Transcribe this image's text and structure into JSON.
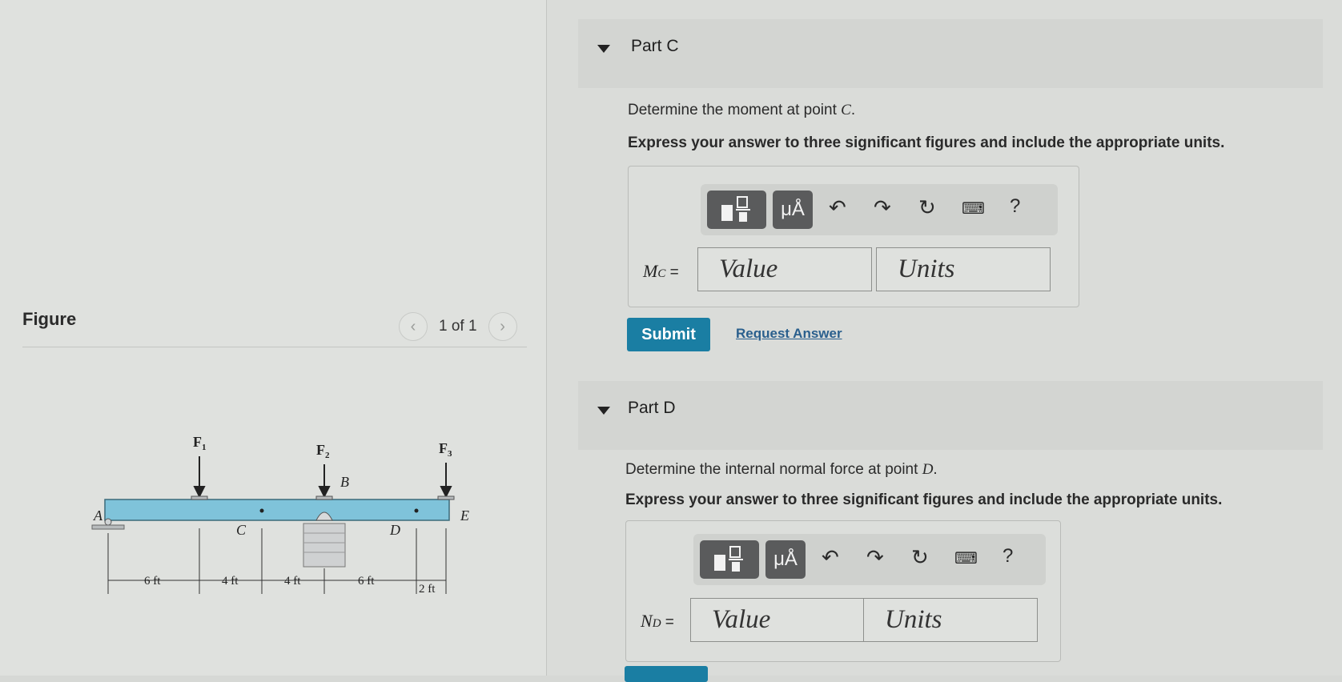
{
  "figure_panel": {
    "heading": "Figure",
    "pager_text": "1 of 1",
    "prev_icon": "chevron-left-icon",
    "next_icon": "chevron-right-icon",
    "diagram": {
      "forces": [
        "F1",
        "F2",
        "F3"
      ],
      "points": [
        "A",
        "B",
        "C",
        "D",
        "E"
      ],
      "dimensions": [
        "6 ft",
        "4 ft",
        "4 ft",
        "6 ft",
        "2 ft"
      ]
    }
  },
  "part_c": {
    "title": "Part C",
    "question_prefix": "Determine the moment at point ",
    "question_var": "C",
    "question_suffix": ".",
    "instruction": "Express your answer to three significant figures and include the appropriate units.",
    "label_main": "M",
    "label_sub": "C",
    "label_eq": " =",
    "value_placeholder": "Value",
    "units_placeholder": "Units",
    "submit_label": "Submit",
    "request_label": "Request Answer"
  },
  "part_d": {
    "title": "Part D",
    "question_prefix": "Determine the internal normal force at point ",
    "question_var": "D",
    "question_suffix": ".",
    "instruction": "Express your answer to three significant figures and include the appropriate units.",
    "label_main": "N",
    "label_sub": "D",
    "label_eq": " =",
    "value_placeholder": "Value",
    "units_placeholder": "Units"
  },
  "toolbar": {
    "template_icon": "fraction-template-icon",
    "units_label": "μÅ",
    "undo_icon": "undo-icon",
    "redo_icon": "redo-icon",
    "reset_icon": "reset-icon",
    "keyboard_icon": "keyboard-icon",
    "help_label": "?"
  },
  "colors": {
    "submit": "#1a7ea3",
    "beam": "#7fc3da",
    "link": "#2a5f8d"
  }
}
